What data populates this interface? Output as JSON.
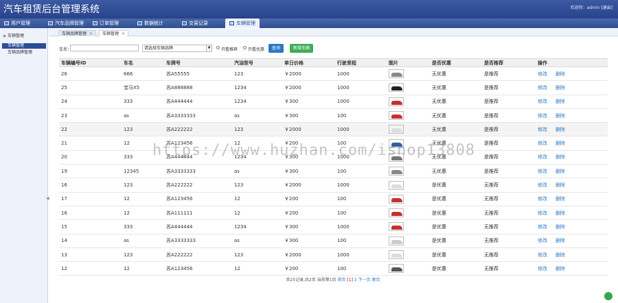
{
  "header": {
    "title": "汽车租赁后台管理系统",
    "welcome": "欢迎你：admin",
    "logout": "[退出]"
  },
  "nav": [
    "用户管理",
    "汽车品牌管理",
    "订单管理",
    "数据统计",
    "交易记录",
    "车辆管理"
  ],
  "sidebar": {
    "title": "车辆管理",
    "items": [
      "车辆管理",
      "车辆品牌管理"
    ]
  },
  "tabs": [
    "车辆品牌管理",
    "车辆管理"
  ],
  "search": {
    "label": "车名：",
    "placeholder": "",
    "select_value": "请选择车辆品牌",
    "radio1": "只看推荐",
    "radio2": "只看优惠",
    "query_btn": "查询",
    "add_btn": "新增车辆"
  },
  "table": {
    "columns": [
      "车辆编号ID",
      "车名",
      "车牌号",
      "汽油型号",
      "单日价格",
      "行驶里程",
      "图片",
      "是否优惠",
      "是否推荐",
      "操作"
    ],
    "rows": [
      [
        "26",
        "666",
        "苏A55555",
        "123",
        "￥2000",
        "1000",
        "无优惠",
        "是推荐"
      ],
      [
        "25",
        "宝马X5",
        "苏A888888",
        "1234",
        "￥2000",
        "1000",
        "无优惠",
        "是推荐"
      ],
      [
        "24",
        "333",
        "苏A444444",
        "1234",
        "￥300",
        "1000",
        "无优惠",
        "是推荐"
      ],
      [
        "23",
        "as",
        "苏A3333333",
        "as",
        "￥300",
        "100",
        "无优惠",
        "是推荐"
      ],
      [
        "22",
        "123",
        "苏A222222",
        "123",
        "￥2000",
        "1000",
        "无优惠",
        "是推荐"
      ],
      [
        "21",
        "12",
        "苏A123456",
        "12",
        "￥200",
        "100",
        "无优惠",
        "是推荐"
      ],
      [
        "20",
        "333",
        "苏A444444",
        "1234",
        "￥300",
        "1000",
        "无优惠",
        "是推荐"
      ],
      [
        "19",
        "12345",
        "苏A3333333",
        "as",
        "￥300",
        "100",
        "无优惠",
        "是推荐"
      ],
      [
        "16",
        "123",
        "苏A222222",
        "123",
        "￥2000",
        "1000",
        "是优惠",
        "无推荐"
      ],
      [
        "17",
        "12",
        "苏A123456",
        "12",
        "￥200",
        "100",
        "是优惠",
        "无推荐"
      ],
      [
        "16",
        "12",
        "苏A111111",
        "12",
        "￥200",
        "100",
        "是优惠",
        "无推荐"
      ],
      [
        "15",
        "333",
        "苏A444444",
        "1234",
        "￥300",
        "1000",
        "是优惠",
        "无推荐"
      ],
      [
        "14",
        "as",
        "苏A3333333",
        "as",
        "￥300",
        "100",
        "是优惠",
        "无推荐"
      ],
      [
        "13",
        "123",
        "苏A222222",
        "123",
        "￥2000",
        "1000",
        "是优惠",
        "无推荐"
      ],
      [
        "12",
        "12",
        "苏A123456",
        "12",
        "￥200",
        "100",
        "是优惠",
        "无推荐"
      ]
    ],
    "op_edit": "修改",
    "op_delete": "删除"
  },
  "car_colors": [
    "#888888",
    "#222222",
    "#c83030",
    "#c83030",
    "#dddddd",
    "#2d5fa8",
    "#777777",
    "#888888",
    "#dddddd",
    "#c83030",
    "#c83030",
    "#c83030",
    "#cccccc",
    "#dddddd",
    "#555555"
  ],
  "pager": {
    "summary": "共25记录,共2页 当前第1页",
    "first": "首页",
    "current": "[1]",
    "next": "2 下一页",
    "last": "尾页"
  },
  "watermark": "https://www.huzhan.com/ishop13808"
}
